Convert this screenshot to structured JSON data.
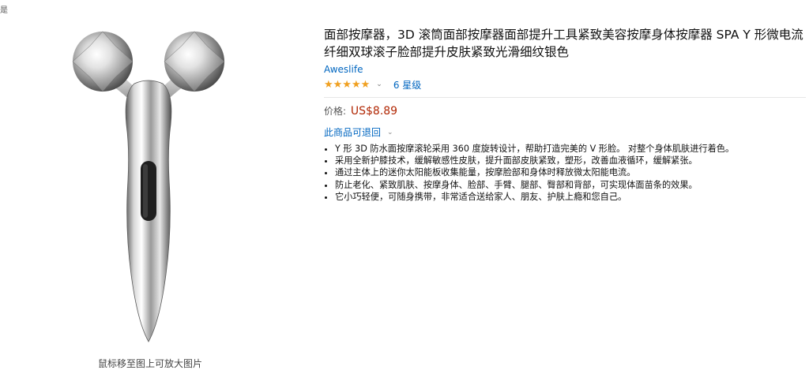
{
  "corner_mark": "是",
  "image_panel": {
    "zoom_hint": "鼠标移至图上可放大图片"
  },
  "product": {
    "title": "面部按摩器，3D 滚筒面部按摩器面部提升工具紧致美容按摩身体按摩器 SPA Y 形微电流纤细双球滚子脸部提升皮肤紧致光滑细纹银色",
    "brand": "Aweslife",
    "rating_stars": "★★★★★",
    "rating_link": "6 星级",
    "price_label": "价格:",
    "price_value": "US$8.89",
    "returns_label": "此商品可退回",
    "bullets": [
      "Y 形 3D 防水面按摩滚轮采用 360 度旋转设计，帮助打造完美的 V 形脸。 对整个身体肌肤进行着色。",
      "采用全新护膝技术，缓解敏感性皮肤，提升面部皮肤紧致，塑形，改善血液循环，缓解紧张。",
      "通过主体上的迷你太阳能板收集能量，按摩脸部和身体时释放微太阳能电流。",
      "防止老化、紧致肌肤、按摩身体、脸部、手臂、腿部、臀部和背部，可实现体面苗条的效果。",
      "它小巧轻便，可随身携带，非常适合送给家人、朋友、护肤上瘾和您自己。"
    ]
  },
  "colors": {
    "link": "#0066c0",
    "price": "#b12704",
    "star": "#f0a020"
  }
}
